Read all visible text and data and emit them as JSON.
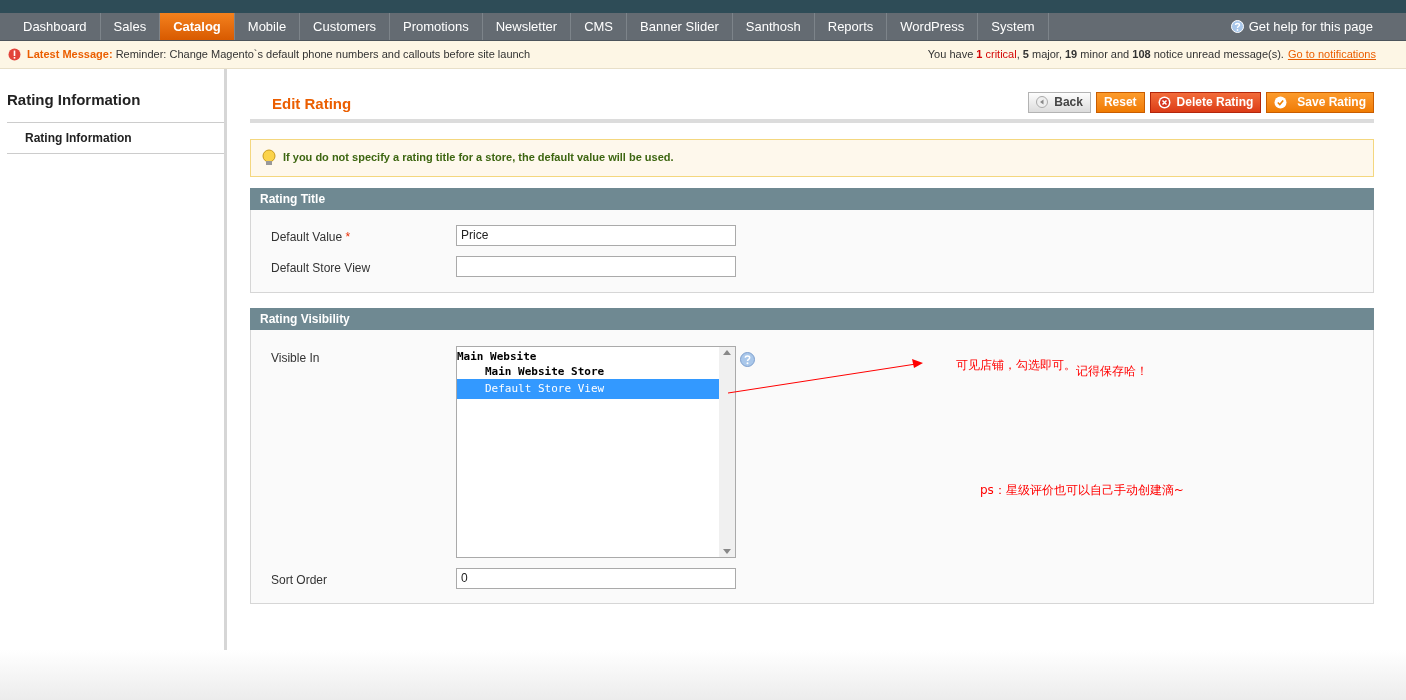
{
  "nav": {
    "tabs": [
      {
        "label": "Dashboard",
        "selected": false
      },
      {
        "label": "Sales",
        "selected": false
      },
      {
        "label": "Catalog",
        "selected": true
      },
      {
        "label": "Mobile",
        "selected": false
      },
      {
        "label": "Customers",
        "selected": false
      },
      {
        "label": "Promotions",
        "selected": false
      },
      {
        "label": "Newsletter",
        "selected": false
      },
      {
        "label": "CMS",
        "selected": false
      },
      {
        "label": "Banner Slider",
        "selected": false
      },
      {
        "label": "Santhosh",
        "selected": false
      },
      {
        "label": "Reports",
        "selected": false
      },
      {
        "label": "WordPress",
        "selected": false
      },
      {
        "label": "System",
        "selected": false
      }
    ],
    "help": "Get help for this page"
  },
  "message_bar": {
    "label": "Latest Message:",
    "text": "Reminder: Change Magento`s default phone numbers and callouts before site launch",
    "summary_prefix": "You have ",
    "summary_critical": "**1** critical",
    "summary_rest": ", **5** major, **19** minor and **108** notice unread message(s).",
    "link": "Go to notifications"
  },
  "sidebar": {
    "title": "Rating Information",
    "items": [
      {
        "label": "Rating Information",
        "selected": true
      }
    ]
  },
  "page_title": "Edit Rating",
  "buttons": [
    {
      "label": "Back",
      "kind": "back"
    },
    {
      "label": "Reset",
      "kind": "reset"
    },
    {
      "label": "Delete Rating",
      "kind": "delete"
    },
    {
      "label": "Save Rating",
      "kind": "save"
    }
  ],
  "notice": "If you do not specify a rating title for a store, the default value will be used.",
  "rating_title": {
    "heading": "Rating Title",
    "fields": [
      {
        "label": "Default Value",
        "required_mark": "*",
        "value": "Price"
      },
      {
        "label": "Default Store View"
      }
    ]
  },
  "rating_visibility": {
    "heading": "Rating Visibility",
    "visible_label": "Visible In",
    "stores": [
      {
        "label": "Main Website",
        "selected": false,
        "children": [
          {
            "label": "Main Website Store",
            "selected": false,
            "children": [
              {
                "label": "Default Store View",
                "selected": true
              }
            ]
          }
        ]
      }
    ],
    "sort_label": "Sort Order",
    "sort_value": "0"
  },
  "annotations": [
    {
      "text": "可见店铺，勾选即可。"
    },
    {
      "text": "记得保存哈！"
    },
    {
      "text": "ps：星级评价也可以自己手动创建滴~"
    }
  ]
}
